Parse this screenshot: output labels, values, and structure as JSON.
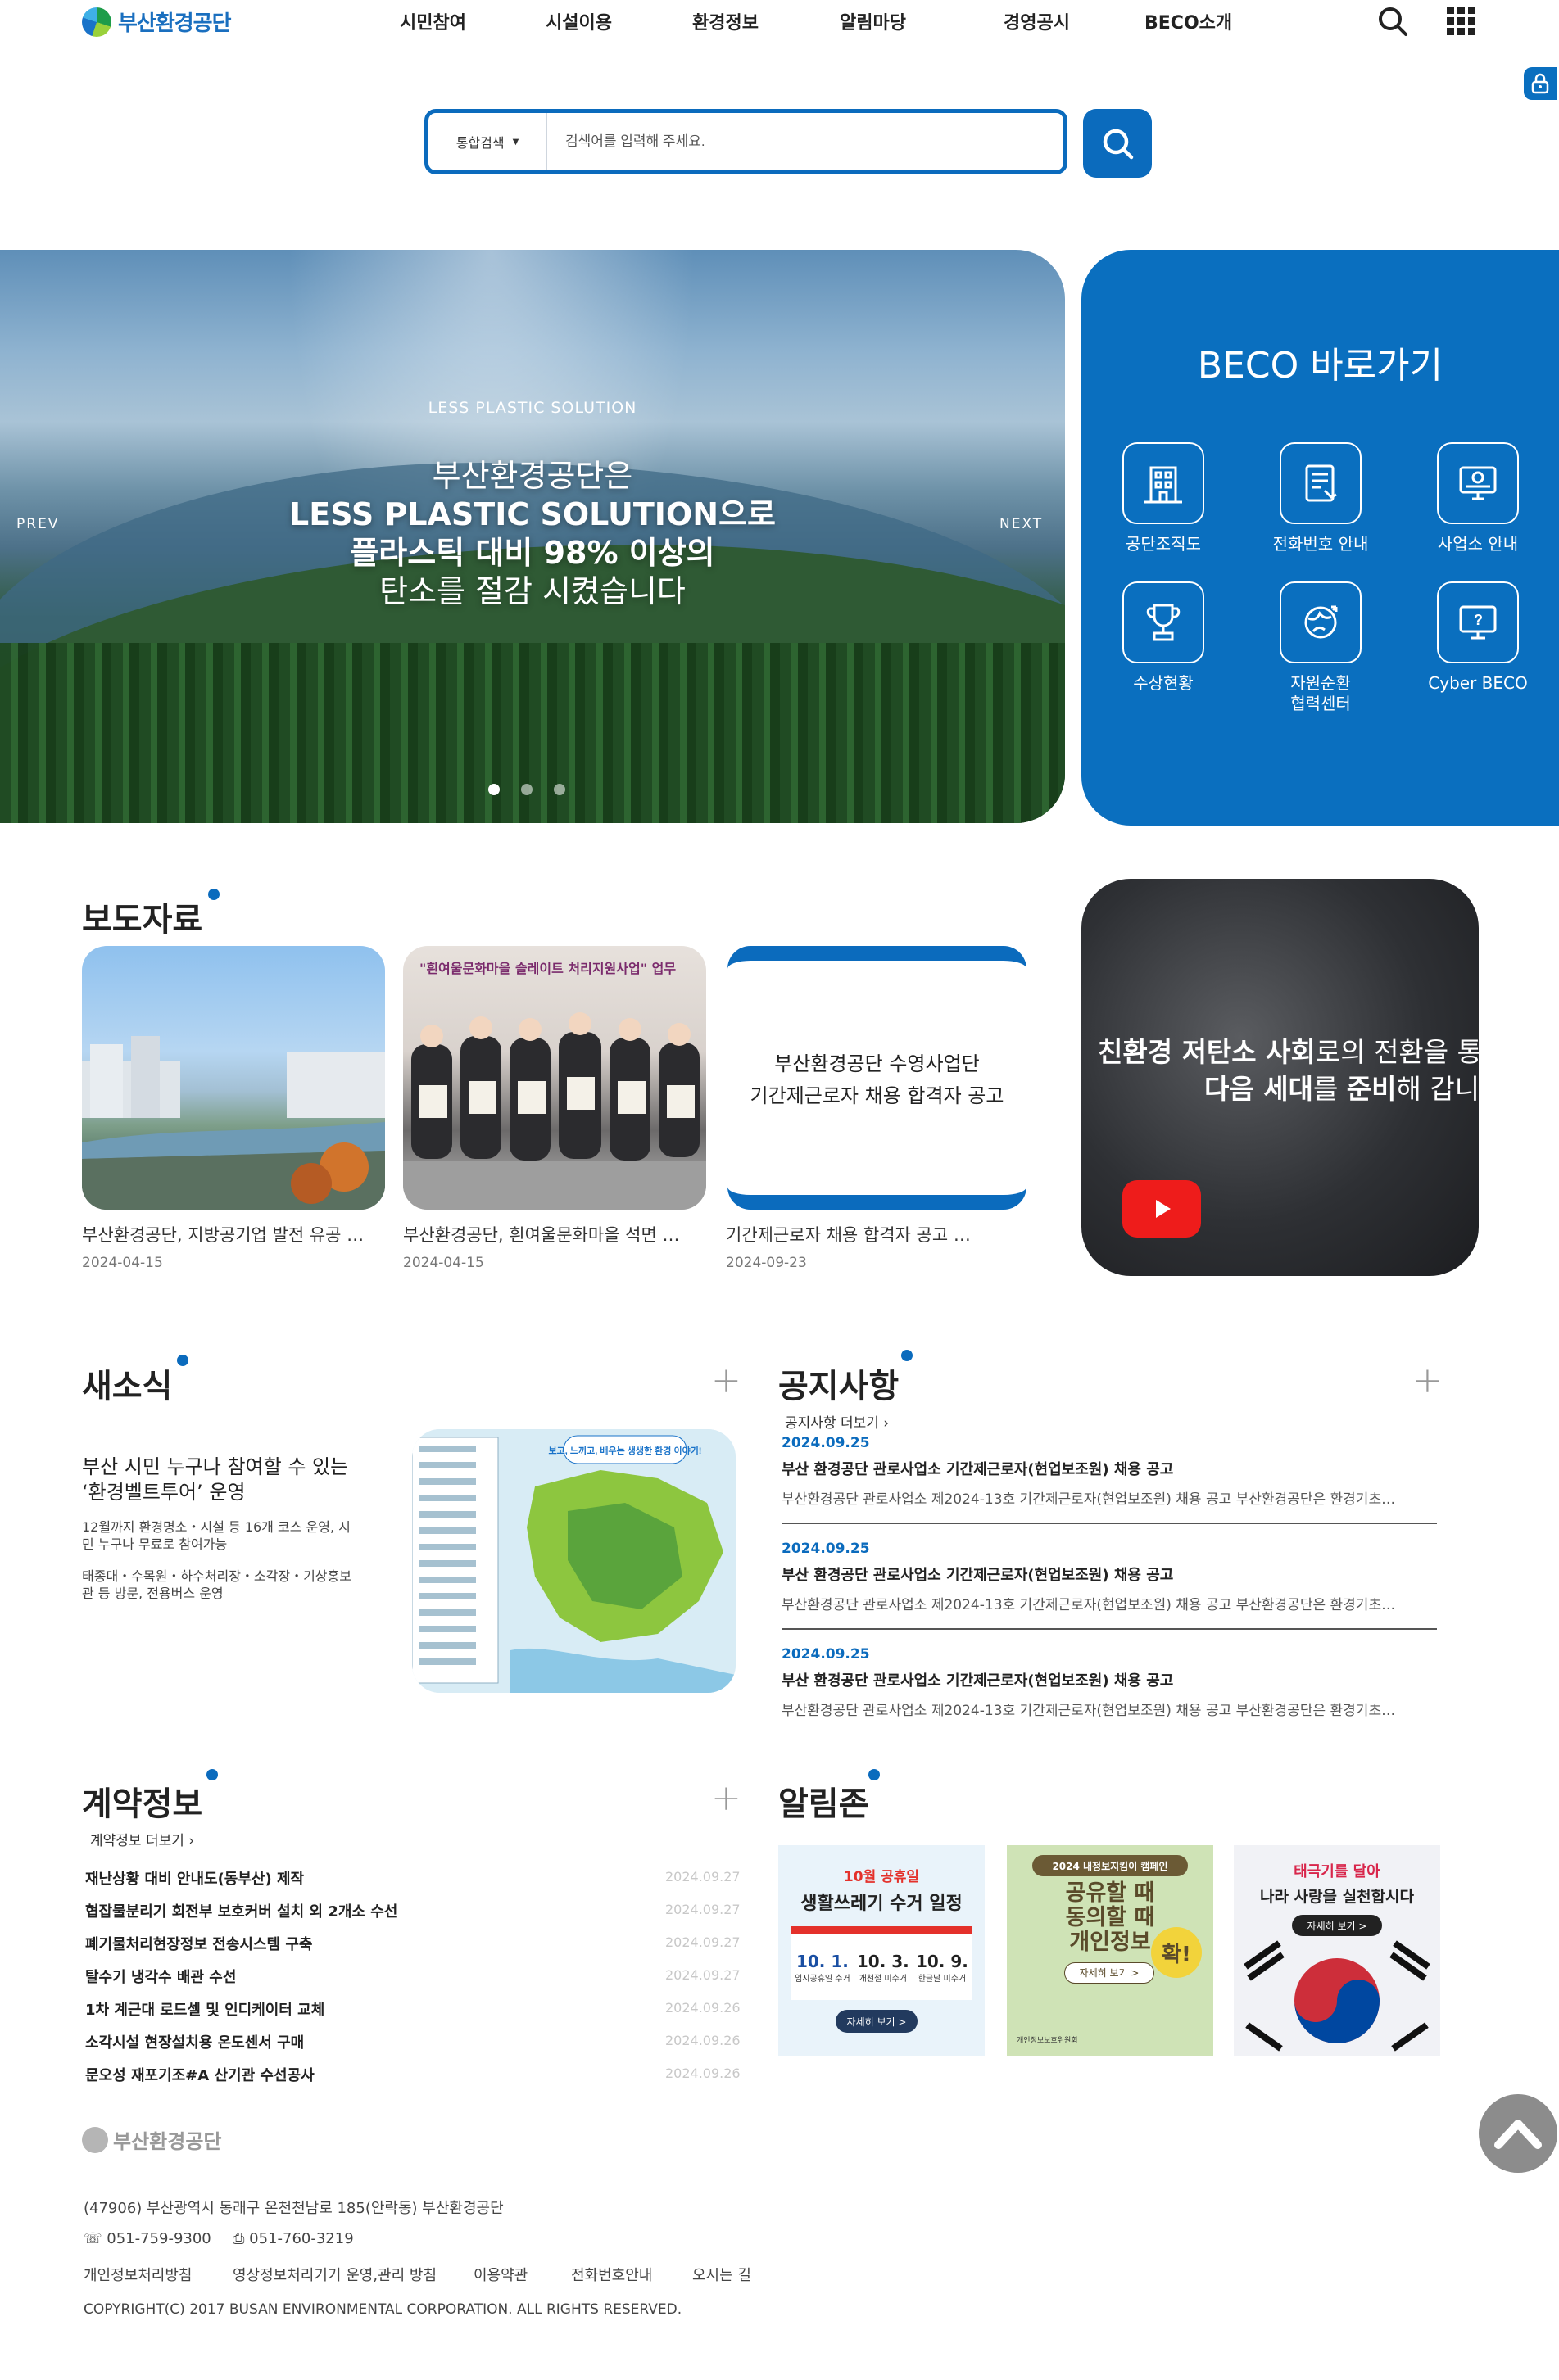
{
  "header": {
    "logo_text": "부산환경공단",
    "nav": [
      "시민참여",
      "시설이용",
      "환경정보",
      "알림마당",
      "경영공시",
      "BECO소개"
    ],
    "icons": [
      "search-icon",
      "grid-menu-icon",
      "lock-icon"
    ]
  },
  "search": {
    "scope_label": "통합검색",
    "placeholder": "검색어를 입력해 주세요."
  },
  "hero": {
    "subtitle": "LESS PLASTIC SOLUTION",
    "line1": "부산환경공단은",
    "line2": "LESS PLASTIC SOLUTION으로",
    "line3": "플라스틱 대비 98% 이상의",
    "line4": "탄소를 절감 시켰습니다",
    "prev_label": "PREV",
    "next_label": "NEXT",
    "slide_count": 3,
    "active_slide": 1
  },
  "quick": {
    "title": "BECO 바로가기",
    "items": [
      {
        "label": "공단조직도",
        "icon": "building-icon"
      },
      {
        "label": "전화번호 안내",
        "icon": "phone-book-icon"
      },
      {
        "label": "사업소 안내",
        "icon": "monitor-map-icon"
      },
      {
        "label": "수상현황",
        "icon": "trophy-icon"
      },
      {
        "label": "자원순환\n협력센터",
        "icon": "recycle-globe-icon"
      },
      {
        "label": "Cyber BECO",
        "icon": "cyber-screen-icon"
      }
    ]
  },
  "press": {
    "title": "보도자료",
    "items": [
      {
        "caption": "부산환경공단, 지방공기업 발전 유공 …",
        "date": "2024-04-15"
      },
      {
        "caption": "부산환경공단, 흰여울문화마을 석면 …",
        "date": "2024-04-15"
      },
      {
        "caption": "기간제근로자 채용 합격자 공고 …",
        "date": "2024-09-23"
      }
    ],
    "card1_banner": "\"흰여울문화마을 슬레이트 처리지원사업\" 업무",
    "card3_text": [
      "부산환경공단 수영사업단",
      "기간제근로자 채용 합격자 공고"
    ]
  },
  "video": {
    "line1_bold": "친환경 저탄소 사회",
    "line1_rest": "로의 전환을 통해",
    "line2_bold": "다음 세대",
    "line2_mid": "를 ",
    "line2_bold2": "준비",
    "line2_rest": "해 갑니다"
  },
  "news": {
    "title": "새소식",
    "headline": "부산 시민 누구나 참여할 수 있는 ‘환경벨트투어’ 운영",
    "desc1": "12월까지 환경명소・시설 등 16개 코스 운영, 시민 누구나 무료로 참여가능",
    "desc2": "태종대・수목원・하수처리장・소각장・기상홍보관 등 방문, 전용버스 운영",
    "map_banner": "보고, 느끼고, 배우는 생생한 환경 이야기!"
  },
  "notice": {
    "title": "공지사항",
    "more_label": "공지사항 더보기",
    "items": [
      {
        "date": "2024.09.25",
        "title": "부산 환경공단 관로사업소 기간제근로자(현업보조원) 채용 공고",
        "body": "부산환경공단 관로사업소 제2024-13호 기간제근로자(현업보조원) 채용 공고 부산환경공단은 환경기초…"
      },
      {
        "date": "2024.09.25",
        "title": "부산 환경공단 관로사업소 기간제근로자(현업보조원) 채용 공고",
        "body": "부산환경공단 관로사업소 제2024-13호 기간제근로자(현업보조원) 채용 공고 부산환경공단은 환경기초…"
      },
      {
        "date": "2024.09.25",
        "title": "부산 환경공단 관로사업소 기간제근로자(현업보조원) 채용 공고",
        "body": "부산환경공단 관로사업소 제2024-13호 기간제근로자(현업보조원) 채용 공고 부산환경공단은 환경기초…"
      }
    ]
  },
  "contract": {
    "title": "계약정보",
    "more_label": "계약정보 더보기",
    "items": [
      {
        "title": "재난상황 대비 안내도(동부산) 제작",
        "date": "2024.09.27"
      },
      {
        "title": "협잡물분리기 회전부 보호커버 설치 외 2개소 수선",
        "date": "2024.09.27"
      },
      {
        "title": "폐기물처리현장정보 전송시스템 구축",
        "date": "2024.09.27"
      },
      {
        "title": "탈수기 냉각수 배관 수선",
        "date": "2024.09.27"
      },
      {
        "title": "1차 계근대 로드셀 및 인디케이터 교체",
        "date": "2024.09.26"
      },
      {
        "title": "소각시설 현장설치용 온도센서 구매",
        "date": "2024.09.26"
      },
      {
        "title": "문오성 재포기조#A 산기관 수선공사",
        "date": "2024.09.26"
      }
    ]
  },
  "alarm": {
    "title": "알림존",
    "banners": [
      {
        "top": "10월 공휴일",
        "title": "생활쓰레기 수거 일정",
        "dates": [
          "10. 1.",
          "10. 3.",
          "10. 9."
        ],
        "date_notes": [
          "임시공휴일 수거",
          "개천절 미수거",
          "한글날 미수거"
        ],
        "button": "자세히 보기 >"
      },
      {
        "top": "2024 내정보지킴이 캠페인",
        "lines": [
          "공유할 때",
          "동의할 때",
          "개인정보"
        ],
        "stamp": "확!",
        "button": "자세히 보기 >",
        "org": "개인정보보호위원회"
      },
      {
        "top": "태극기를 달아",
        "title": "나라 사랑을 실천합시다",
        "button": "자세히 보기 >"
      }
    ]
  },
  "footer": {
    "logo_text": "부산환경공단",
    "address": "(47906) 부산광역시 동래구 온천천남로 185(안락동) 부산환경공단",
    "phone": "051-759-9300",
    "fax": "051-760-3219",
    "links": [
      "개인정보처리방침",
      "영상정보처리기기 운영,관리 방침",
      "이용약관",
      "전화번호안내",
      "오시는 길"
    ],
    "copyright": "COPYRIGHT(C) 2017 BUSAN ENVIRONMENTAL CORPORATION. ALL RIGHTS RESERVED."
  }
}
